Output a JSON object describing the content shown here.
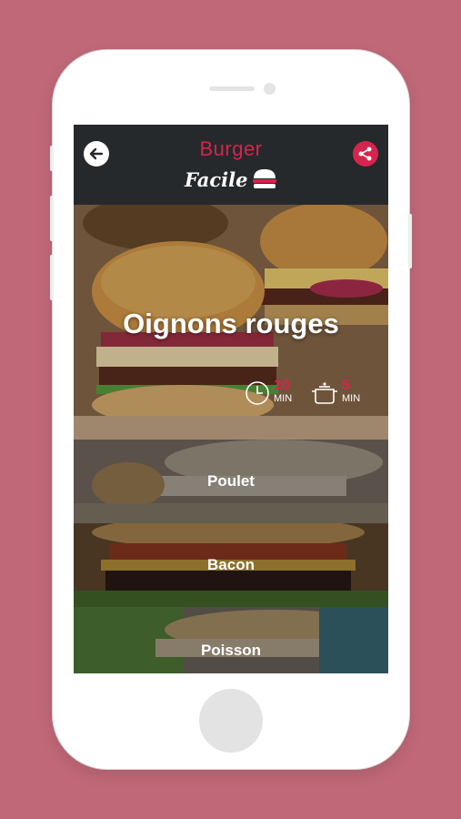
{
  "colors": {
    "background": "#c06878",
    "accent": "#d6244d",
    "appbar": "#26292c"
  },
  "header": {
    "back_icon": "arrow-left-icon",
    "logo_top": "Burger",
    "logo_bottom": "Facile",
    "logo_icon": "burger-icon",
    "share_icon": "share-icon"
  },
  "recipe": {
    "title": "Oignons rouges",
    "prep_time": {
      "icon": "clock-icon",
      "value": "10",
      "unit": "MIN"
    },
    "cook_time": {
      "icon": "pot-icon",
      "value": "5",
      "unit": "MIN"
    }
  },
  "categories": [
    {
      "label": "Poulet"
    },
    {
      "label": "Bacon"
    },
    {
      "label": "Poisson"
    }
  ]
}
